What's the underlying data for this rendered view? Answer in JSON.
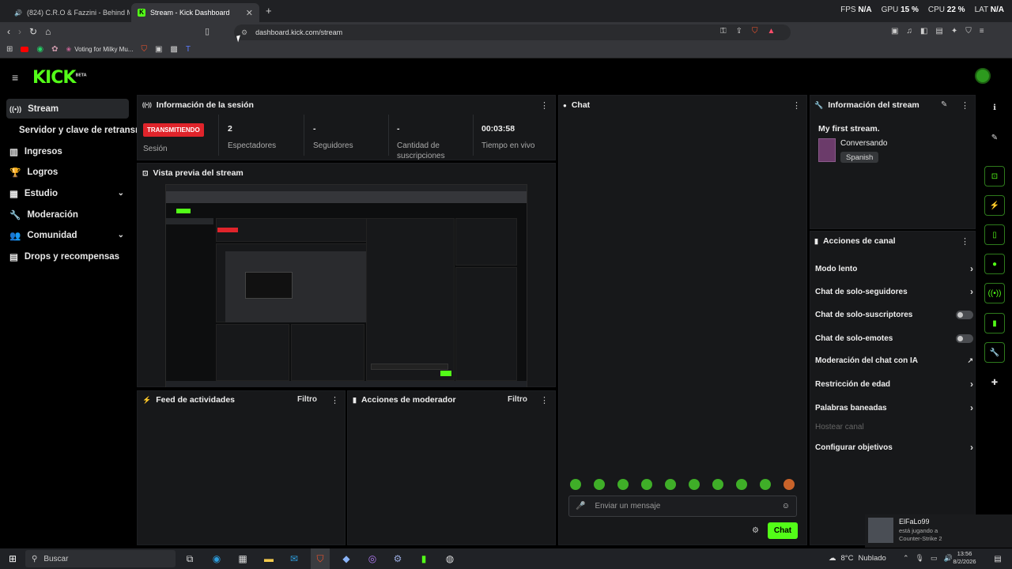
{
  "browser": {
    "tabs": [
      {
        "title": "(824) C.R.O & Fazzini - Behind M"
      },
      {
        "title": "Stream - Kick Dashboard"
      }
    ],
    "new_tab": "+",
    "perf": {
      "fps_label": "FPS",
      "fps_val": "N/A",
      "gpu_label": "GPU",
      "gpu_val": "15 %",
      "cpu_label": "CPU",
      "cpu_val": "22 %",
      "lat_label": "LAT",
      "lat_val": "N/A"
    },
    "url": "dashboard.kick.com/stream",
    "bookmarks": [
      {
        "label": "Voting for Milky Mu..."
      }
    ]
  },
  "app": {
    "logo": "KICK",
    "logo_badge": "BETA",
    "sidebar": [
      {
        "label": "Stream"
      },
      {
        "label": "Servidor y clave de retransm"
      },
      {
        "label": "Ingresos"
      },
      {
        "label": "Logros"
      },
      {
        "label": "Estudio"
      },
      {
        "label": "Moderación"
      },
      {
        "label": "Comunidad"
      },
      {
        "label": "Drops y recompensas"
      }
    ],
    "session": {
      "title": "Información de la sesión",
      "live_badge": "TRANSMITIENDO",
      "session_label": "Sesión",
      "viewers_val": "2",
      "viewers_label": "Espectadores",
      "followers_val": "-",
      "followers_label": "Seguidores",
      "subs_val": "-",
      "subs_label": "Cantidad de suscripciones",
      "time_val": "00:03:58",
      "time_label": "Tiempo en vivo"
    },
    "preview": {
      "title": "Vista previa del stream"
    },
    "feed": {
      "title": "Feed de actividades",
      "filter": "Filtro"
    },
    "modactions": {
      "title": "Acciones de moderador",
      "filter": "Filtro"
    },
    "chat": {
      "title": "Chat",
      "placeholder": "Enviar un mensaje",
      "send": "Chat"
    },
    "streaminfo": {
      "title": "Información del stream",
      "stream_title": "My first stream.",
      "category": "Conversando",
      "language": "Spanish"
    },
    "channel_actions": {
      "title": "Acciones de canal",
      "items": [
        {
          "label": "Modo lento"
        },
        {
          "label": "Chat de solo-seguidores"
        },
        {
          "label": "Chat de solo-suscriptores"
        },
        {
          "label": "Chat de solo-emotes"
        },
        {
          "label": "Moderación del chat con IA"
        },
        {
          "label": "Restricción de edad"
        },
        {
          "label": "Palabras baneadas"
        },
        {
          "label": "Hostear canal"
        },
        {
          "label": "Configurar objetivos"
        }
      ]
    }
  },
  "notification": {
    "user": "ElFaLo99",
    "line1": "está jugando a",
    "line2": "Counter-Strike 2"
  },
  "taskbar": {
    "search": "Buscar",
    "weather": "8°C",
    "weather_desc": "Nublado",
    "time": "13:56",
    "date": "8/2/2026"
  },
  "colors": {
    "kick_green": "#53fc18",
    "live_red": "#e0242b",
    "panel_bg": "#17181a"
  }
}
